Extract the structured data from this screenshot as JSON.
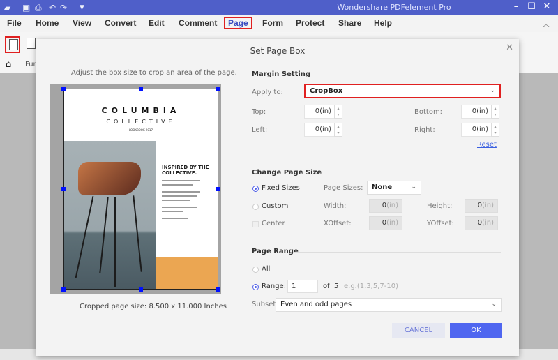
{
  "window": {
    "title": "Wondershare PDFelement Pro",
    "controls": [
      "minimize-icon",
      "maximize-icon",
      "close-icon"
    ]
  },
  "quick_access": [
    "app-logo-icon",
    "save-icon",
    "print-icon",
    "undo-icon",
    "redo-icon",
    "customize-icon"
  ],
  "menu": {
    "items": [
      "File",
      "Home",
      "View",
      "Convert",
      "Edit",
      "Comment",
      "Page",
      "Form",
      "Protect",
      "Share",
      "Help"
    ],
    "active": "Page"
  },
  "toolbar": {
    "tools": [
      "set-page-box-icon",
      "replace-page-icon",
      "tool-3-icon",
      "tool-4-icon",
      "tool-5-icon",
      "tool-6-icon"
    ],
    "selected": "set-page-box-icon"
  },
  "tabbar": {
    "home_icon": "home-icon",
    "tab_label": "Fur"
  },
  "dialog": {
    "title": "Set Page Box",
    "close_icon": "close-icon",
    "hint": "Adjust the box size to crop an area of the page.",
    "preview": {
      "heading1": "COLUMBIA",
      "heading2": "COLLECTIVE",
      "subtitle": "LOOKBOOK 2017",
      "inspired": "INSPIRED BY THE COLLECTIVE."
    },
    "cropped_size": "Cropped page size: 8.500 x 11.000 Inches",
    "margin": {
      "section": "Margin Setting",
      "apply_label": "Apply to:",
      "apply_value": "CropBox",
      "top_label": "Top:",
      "top_value": "0",
      "bottom_label": "Bottom:",
      "bottom_value": "0",
      "left_label": "Left:",
      "left_value": "0",
      "right_label": "Right:",
      "right_value": "0",
      "unit": "(in)",
      "reset": "Reset"
    },
    "page_size": {
      "section": "Change Page Size",
      "fixed_label": "Fixed Sizes",
      "custom_label": "Custom",
      "center_label": "Center",
      "page_sizes_label": "Page Sizes:",
      "page_sizes_value": "None",
      "width_label": "Width:",
      "width_value": "0",
      "height_label": "Height:",
      "height_value": "0",
      "xoffset_label": "XOffset:",
      "xoffset_value": "0",
      "yoffset_label": "YOffset:",
      "yoffset_value": "0",
      "unit": "(in)",
      "selected": "Fixed Sizes"
    },
    "page_range": {
      "section": "Page Range",
      "all_label": "All",
      "range_label": "Range:",
      "range_value": "1",
      "of_label": "of",
      "total": "5",
      "example": "e.g.(1,3,5,7-10)",
      "selected": "Range",
      "subset_label": "Subset:",
      "subset_value": "Even and odd pages"
    },
    "buttons": {
      "cancel": "CANCEL",
      "ok": "OK"
    }
  },
  "colors": {
    "titlebar": "#4f5fc9",
    "highlight": "#e02020",
    "ok": "#4f66f0",
    "handle": "#0010ff"
  }
}
